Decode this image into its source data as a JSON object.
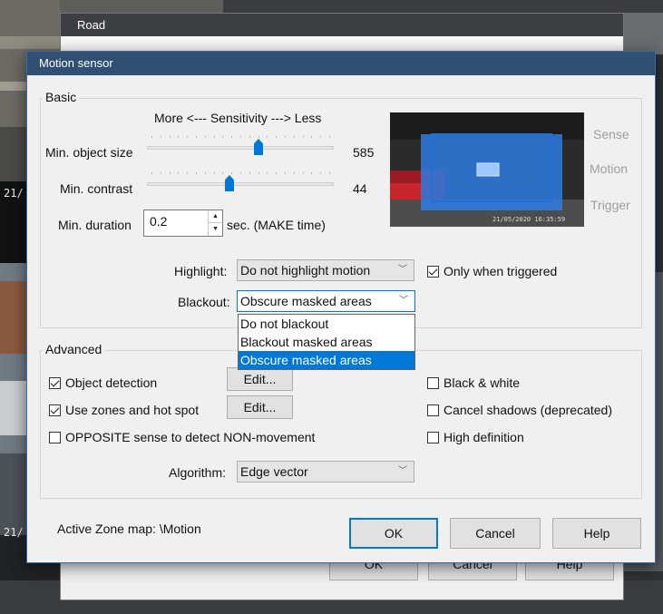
{
  "background": {
    "timestamp_left_1": "21/",
    "timestamp_left_2": "21/",
    "road_window": {
      "title": "Road",
      "ok_label": "OK",
      "cancel_label": "Cancel",
      "help_label": "Help"
    }
  },
  "dialog": {
    "title": "Motion sensor",
    "basic": {
      "group_label": "Basic",
      "sensitivity_caption": "More <--- Sensitivity ---> Less",
      "min_object_size": {
        "label": "Min. object size",
        "value": "585",
        "level": 0.6
      },
      "min_contrast": {
        "label": "Min. contrast",
        "value": "44",
        "level": 0.44
      },
      "min_duration": {
        "label": "Min. duration",
        "value": "0.2",
        "unit": "sec.  (MAKE time)"
      },
      "preview": {
        "timestamp": "21/05/2020 16:35:59",
        "legend": [
          "Sense",
          "Motion",
          "Trigger"
        ]
      },
      "highlight": {
        "label": "Highlight:",
        "value": "Do not highlight motion"
      },
      "only_when_triggered": {
        "label": "Only when triggered",
        "checked": true
      },
      "blackout": {
        "label": "Blackout:",
        "value": "Obscure masked areas",
        "options": [
          "Do not blackout",
          "Blackout masked areas",
          "Obscure masked areas"
        ],
        "selected_index": 2
      }
    },
    "advanced": {
      "group_label": "Advanced",
      "object_detection": {
        "label": "Object detection",
        "checked": true,
        "edit_label": "Edit..."
      },
      "zones_hot_spot": {
        "label": "Use zones and hot spot",
        "checked": true,
        "edit_label": "Edit..."
      },
      "opposite_sense": {
        "label": "OPPOSITE sense to detect NON-movement",
        "checked": false
      },
      "black_white": {
        "label": "Black & white",
        "checked": false
      },
      "cancel_shadows": {
        "label": "Cancel shadows (deprecated)",
        "checked": false
      },
      "high_definition": {
        "label": "High definition",
        "checked": false
      },
      "algorithm": {
        "label": "Algorithm:",
        "value": "Edge vector"
      }
    },
    "footer": {
      "zone_map": "Active Zone map:  \\Motion",
      "ok_label": "OK",
      "cancel_label": "Cancel",
      "help_label": "Help"
    }
  },
  "colors": {
    "accent": "#0078d7",
    "dialog_title": "#2f4f73",
    "preview_sense": "#2d7fe6"
  }
}
